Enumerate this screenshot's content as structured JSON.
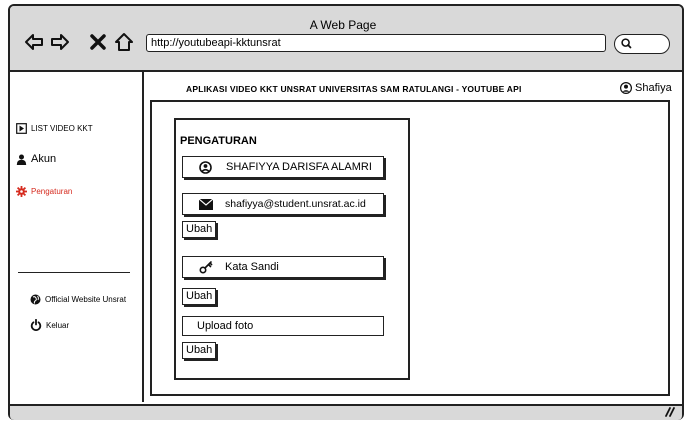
{
  "browser": {
    "window_title": "A Web Page",
    "url": "http://youtubeapi-kktunsrat"
  },
  "header": {
    "app_title": "APLIKASI VIDEO KKT UNSRAT UNIVERSITAS SAM RATULANGI - YOUTUBE API",
    "username": "Shafiya"
  },
  "sidebar": {
    "items": [
      {
        "label": "LIST VIDEO KKT"
      },
      {
        "label": "Akun"
      },
      {
        "label": "Pengaturan",
        "active_color": "#d62b1f"
      }
    ],
    "footer_items": [
      {
        "label": "Official Website Unsrat"
      },
      {
        "label": "Keluar"
      }
    ]
  },
  "settings": {
    "title": "PENGATURAN",
    "name_value": "SHAFIYYA DARISFA ALAMRI",
    "email_value": "shafiyya@student.unsrat.ac.id",
    "password_placeholder": "Kata Sandi",
    "upload_label": "Upload foto",
    "change_label": "Ubah"
  }
}
